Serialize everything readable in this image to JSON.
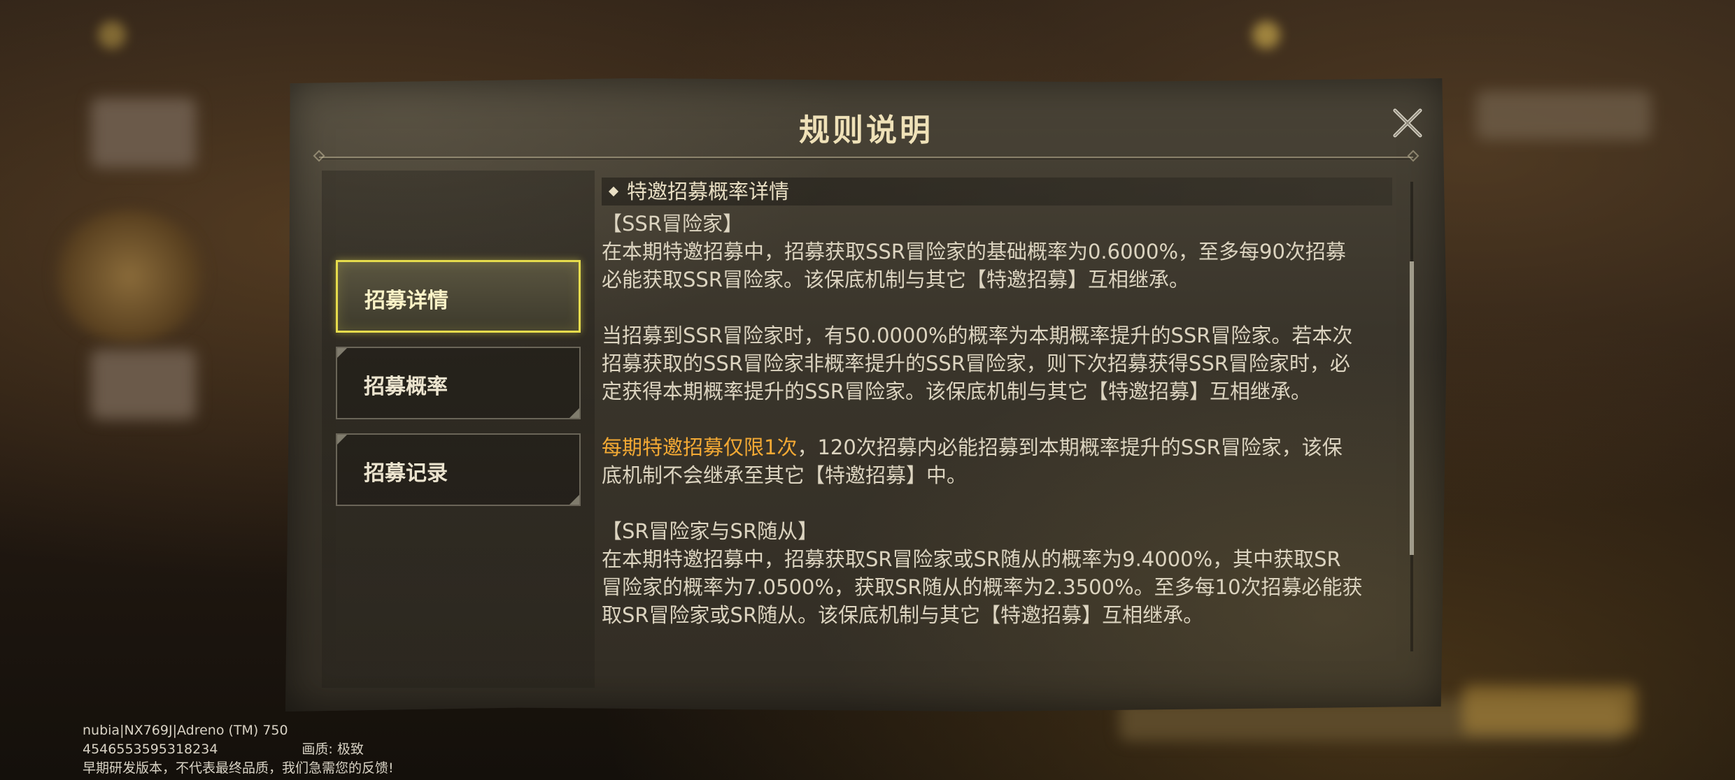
{
  "dialog": {
    "title": "规则说明",
    "close_icon": "close-icon"
  },
  "tabs": [
    {
      "label": "招募详情",
      "active": true
    },
    {
      "label": "招募概率",
      "active": false
    },
    {
      "label": "招募记录",
      "active": false
    }
  ],
  "content": {
    "section_header": "特邀招募概率详情",
    "ssr_title": "【SSR冒险家】",
    "ssr_p1_l1": "在本期特邀招募中，招募获取SSR冒险家的基础概率为0.6000%，至多每90次招募",
    "ssr_p1_l2": "必能获取SSR冒险家。该保底机制与其它【特邀招募】互相继承。",
    "ssr_p2_l1": "当招募到SSR冒险家时，有50.0000%的概率为本期概率提升的SSR冒险家。若本次",
    "ssr_p2_l2": "招募获取的SSR冒险家非概率提升的SSR冒险家，则下次招募获得SSR冒险家时，必",
    "ssr_p2_l3": "定获得本期概率提升的SSR冒险家。该保底机制与其它【特邀招募】互相继承。",
    "ssr_p3_highlight": "每期特邀招募仅限1次",
    "ssr_p3_l1_rest": "，120次招募内必能招募到本期概率提升的SSR冒险家，该保",
    "ssr_p3_l2": "底机制不会继承至其它【特邀招募】中。",
    "sr_title": "【SR冒险家与SR随从】",
    "sr_p1_l1": "在本期特邀招募中，招募获取SR冒险家或SR随从的概率为9.4000%，其中获取SR",
    "sr_p1_l2": "冒险家的概率为7.0500%，获取SR随从的概率为2.3500%。至多每10次招募必能获",
    "sr_p1_l3": "取SR冒险家或SR随从。该保底机制与其它【特邀招募】互相继承。"
  },
  "debug": {
    "device": "nubia|NX769J|Adreno (TM) 750",
    "id": "4546553595318234",
    "quality": "画质: 极致",
    "notice": "早期研发版本，不代表最终品质，我们急需您的反馈!"
  },
  "colors": {
    "highlight": "#f3a934",
    "active_tab_border": "#e6dc4c",
    "title": "#efe1b8"
  }
}
